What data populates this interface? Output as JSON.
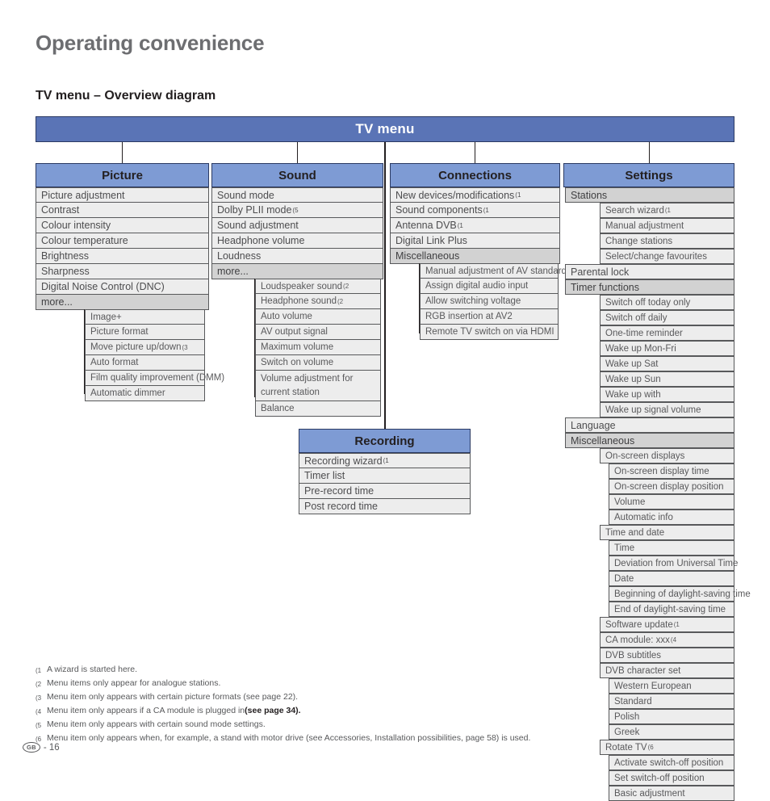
{
  "document": {
    "title": "Operating convenience",
    "section_title": "TV menu – Overview diagram",
    "page_label": "GB",
    "page_number": "- 16"
  },
  "diagram": {
    "root_label": "TV menu",
    "columns": [
      {
        "id": "picture",
        "title": "Picture",
        "items": [
          {
            "label": "Picture adjustment",
            "level": 0
          },
          {
            "label": "Contrast",
            "level": 0
          },
          {
            "label": "Colour intensity",
            "level": 0
          },
          {
            "label": "Colour temperature",
            "level": 0
          },
          {
            "label": "Brightness",
            "level": 0
          },
          {
            "label": "Sharpness",
            "level": 0
          },
          {
            "label": "Digital Noise Control (DNC)",
            "level": 0
          },
          {
            "label": "more...",
            "level": 0,
            "parent": true
          }
        ],
        "submenu": [
          {
            "label": "Image+"
          },
          {
            "label": "Picture format"
          },
          {
            "label": "Move picture up/down",
            "note": "(3"
          },
          {
            "label": "Auto format"
          },
          {
            "label": "Film quality improvement (DMM)"
          },
          {
            "label": "Automatic dimmer"
          }
        ]
      },
      {
        "id": "sound",
        "title": "Sound",
        "items": [
          {
            "label": "Sound mode",
            "level": 0
          },
          {
            "label": "Dolby PLII mode",
            "level": 0,
            "note": "(5"
          },
          {
            "label": "Sound adjustment",
            "level": 0
          },
          {
            "label": "Headphone volume",
            "level": 0
          },
          {
            "label": "Loudness",
            "level": 0
          },
          {
            "label": "more...",
            "level": 0,
            "parent": true
          }
        ],
        "submenu": [
          {
            "label": "Loudspeaker sound",
            "note": "(2"
          },
          {
            "label": "Headphone sound",
            "note": "(2"
          },
          {
            "label": "Auto volume"
          },
          {
            "label": "AV output signal"
          },
          {
            "label": "Maximum volume"
          },
          {
            "label": "Switch on volume"
          },
          {
            "label": "Volume adjustment for current station",
            "tall": true
          },
          {
            "label": "Balance"
          }
        ]
      },
      {
        "id": "connections",
        "title": "Connections",
        "items": [
          {
            "label": "New devices/modifications",
            "level": 0,
            "note": "(1"
          },
          {
            "label": "Sound components",
            "level": 0,
            "note": "(1"
          },
          {
            "label": "Antenna DVB",
            "level": 0,
            "note": "(1"
          },
          {
            "label": "Digital Link Plus",
            "level": 0
          },
          {
            "label": "Miscellaneous",
            "level": 0,
            "parent": true
          }
        ],
        "submenu": [
          {
            "label": "Manual adjustment of AV standard"
          },
          {
            "label": "Assign digital audio input"
          },
          {
            "label": "Allow switching voltage"
          },
          {
            "label": "RGB insertion at AV2"
          },
          {
            "label": "Remote TV switch on via HDMI"
          }
        ]
      },
      {
        "id": "settings",
        "title": "Settings",
        "items": [
          {
            "label": "Stations",
            "level": 1,
            "parent": true
          },
          {
            "label": "Search wizard",
            "level": 2,
            "note": "(1"
          },
          {
            "label": "Manual adjustment",
            "level": 2
          },
          {
            "label": "Change stations",
            "level": 2
          },
          {
            "label": "Select/change favourites",
            "level": 2
          },
          {
            "label": "Parental lock",
            "level": 1
          },
          {
            "label": "Timer functions",
            "level": 1,
            "parent": true
          },
          {
            "label": "Switch off today only",
            "level": 2
          },
          {
            "label": "Switch off daily",
            "level": 2
          },
          {
            "label": "One-time reminder",
            "level": 2
          },
          {
            "label": "Wake up Mon-Fri",
            "level": 2
          },
          {
            "label": "Wake up Sat",
            "level": 2
          },
          {
            "label": "Wake up Sun",
            "level": 2
          },
          {
            "label": "Wake up with",
            "level": 2
          },
          {
            "label": "Wake up signal volume",
            "level": 2
          },
          {
            "label": "Language",
            "level": 1
          },
          {
            "label": "Miscellaneous",
            "level": 1,
            "parent": true
          },
          {
            "label": "On-screen displays",
            "level": 2,
            "parent": true
          },
          {
            "label": "On-screen display time",
            "level": 3
          },
          {
            "label": "On-screen display position",
            "level": 3
          },
          {
            "label": "Volume",
            "level": 3
          },
          {
            "label": "Automatic info",
            "level": 3
          },
          {
            "label": "Time and date",
            "level": 2,
            "parent": true
          },
          {
            "label": "Time",
            "level": 3
          },
          {
            "label": "Deviation from Universal Time",
            "level": 3
          },
          {
            "label": "Date",
            "level": 3
          },
          {
            "label": "Beginning of daylight-saving time",
            "level": 3
          },
          {
            "label": "End of daylight-saving time",
            "level": 3
          },
          {
            "label": "Software update",
            "level": 2,
            "parent": true,
            "note": "(1"
          },
          {
            "label": "CA module: xxx",
            "level": 2,
            "parent": true,
            "note": "(4"
          },
          {
            "label": "DVB subtitles",
            "level": 2,
            "parent": true
          },
          {
            "label": "DVB character set",
            "level": 2,
            "parent": true
          },
          {
            "label": "Western European",
            "level": 3
          },
          {
            "label": "Standard",
            "level": 3
          },
          {
            "label": "Polish",
            "level": 3
          },
          {
            "label": "Greek",
            "level": 3
          },
          {
            "label": "Rotate TV",
            "level": 2,
            "parent": true,
            "note": "(6"
          },
          {
            "label": "Activate switch-off position",
            "level": 3
          },
          {
            "label": "Set switch-off position",
            "level": 3
          },
          {
            "label": "Basic adjustment",
            "level": 3
          }
        ],
        "submenu": []
      },
      {
        "id": "recording",
        "title": "Recording",
        "items": [
          {
            "label": "Recording wizard",
            "level": 0,
            "note": "(1"
          },
          {
            "label": "Timer list",
            "level": 0
          },
          {
            "label": "Pre-record time",
            "level": 0
          },
          {
            "label": "Post record time",
            "level": 0
          }
        ],
        "submenu": []
      }
    ]
  },
  "footnotes": [
    {
      "mark": "(1",
      "text": "A wizard is started here."
    },
    {
      "mark": "(2",
      "text": "Menu items only appear for analogue stations."
    },
    {
      "mark": "(3",
      "text": "Menu item only appears with certain picture formats (see page 22)."
    },
    {
      "mark": "(4",
      "text": "Menu item only appears if a CA module is plugged in ",
      "bold": "(see page 34)."
    },
    {
      "mark": "(5",
      "text": "Menu item only appears with certain sound mode settings."
    },
    {
      "mark": "(6",
      "text": "Menu item only appears when, for example, a stand with motor drive (see Accessories, Installation possibilities, page 58) is used."
    }
  ],
  "colors": {
    "root_bar": "#5a74b6",
    "column_header": "#7e9bd4",
    "row": "#ededed",
    "row_parent": "#d2d2d2"
  }
}
